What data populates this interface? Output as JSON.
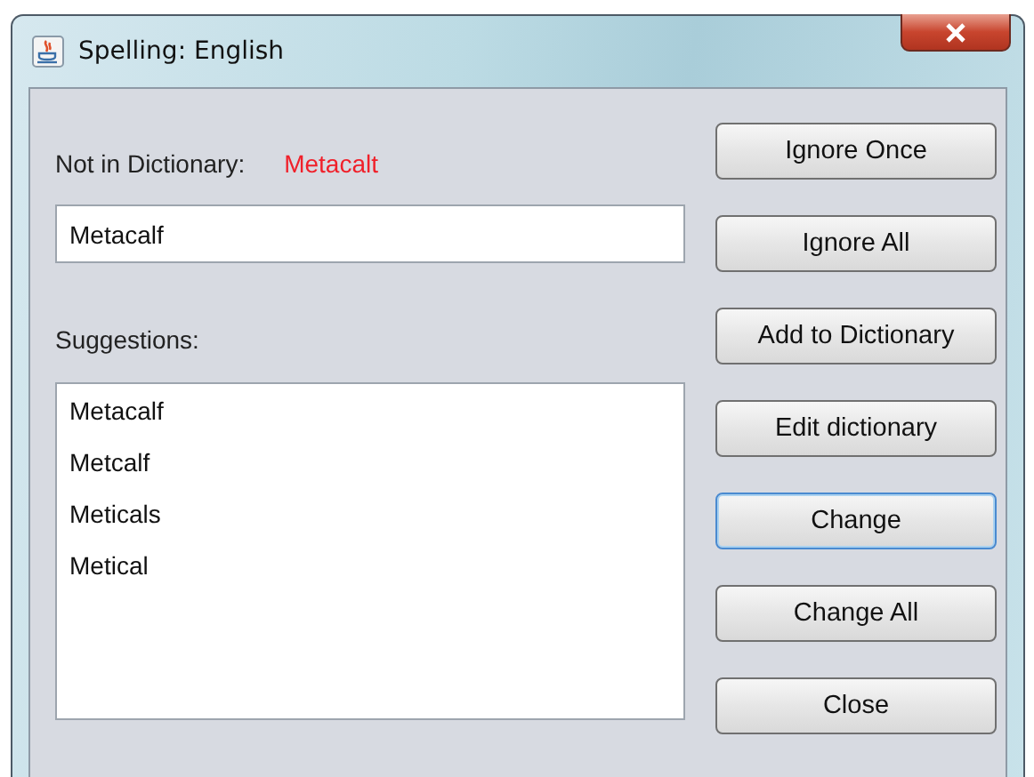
{
  "window": {
    "title": "Spelling: English"
  },
  "not_in_dictionary": {
    "label": "Not in Dictionary:",
    "word": "Metacalt"
  },
  "replacement_field": {
    "value": "Metacalf"
  },
  "suggestions": {
    "label": "Suggestions:",
    "items": [
      {
        "text": "Metacalf",
        "selected": false
      },
      {
        "text": "Metcalf",
        "selected": false
      },
      {
        "text": "Meticals",
        "selected": false
      },
      {
        "text": "Metical",
        "selected": false
      }
    ]
  },
  "buttons": [
    {
      "label": "Ignore Once",
      "focused": false
    },
    {
      "label": "Ignore All",
      "focused": false
    },
    {
      "label": "Add to Dictionary",
      "focused": false
    },
    {
      "label": "Edit dictionary",
      "focused": false
    },
    {
      "label": "Change",
      "focused": true
    },
    {
      "label": "Change All",
      "focused": false
    },
    {
      "label": "Close",
      "focused": false
    }
  ]
}
